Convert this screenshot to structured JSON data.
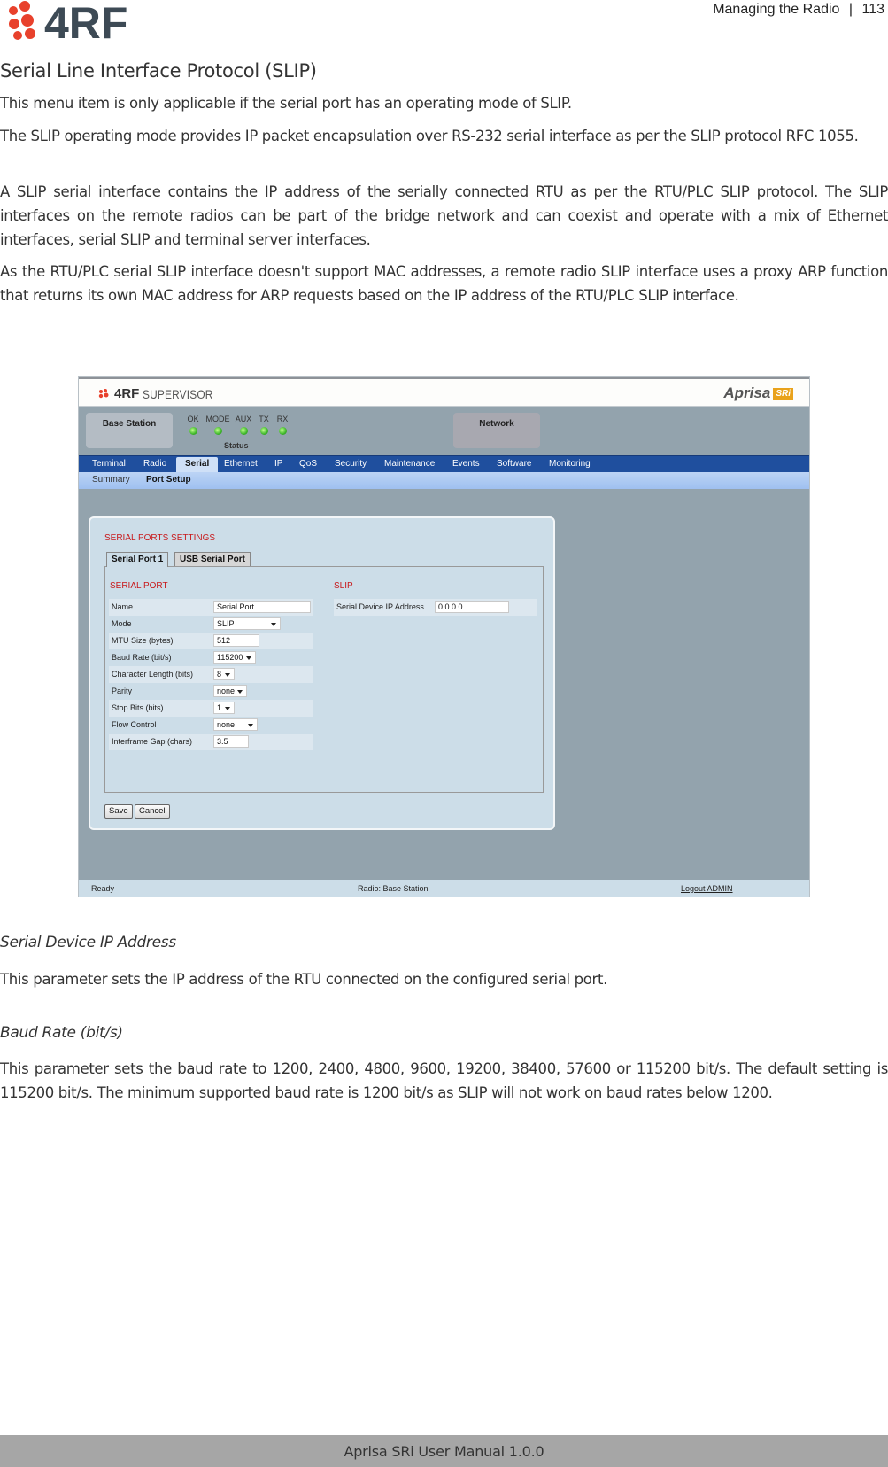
{
  "header": {
    "logo_text": "4RF",
    "section": "Managing the Radio",
    "separator": "|",
    "page_number": "113"
  },
  "title": "Serial Line Interface Protocol (SLIP)",
  "paragraphs": [
    "This menu item is only applicable if the serial port has an operating mode of SLIP.",
    "The SLIP operating mode provides IP packet encapsulation over RS-232 serial interface as per the SLIP protocol RFC 1055.",
    "A SLIP serial interface contains the IP address of the serially connected RTU as per the RTU/PLC SLIP protocol. The SLIP interfaces on the remote radios can be part of the bridge network and can coexist and operate with a mix of Ethernet interfaces, serial SLIP and terminal server interfaces.",
    "As the RTU/PLC serial SLIP interface doesn't support MAC addresses, a remote radio SLIP interface uses a proxy ARP function that returns its own MAC address for ARP requests based on the IP address of the RTU/PLC SLIP interface."
  ],
  "screenshot": {
    "app_logo": "4RF",
    "app_name": "SUPERVISOR",
    "brand": "Aprisa",
    "brand_badge": "SRi",
    "station_label": "Base Station",
    "network_label": "Network",
    "status_label": "Status",
    "leds": [
      {
        "label": "OK",
        "state": "green"
      },
      {
        "label": "MODE",
        "state": "green"
      },
      {
        "label": "AUX",
        "state": "green"
      },
      {
        "label": "TX",
        "state": "green"
      },
      {
        "label": "RX",
        "state": "green"
      }
    ],
    "nav": [
      "Terminal",
      "Radio",
      "Serial",
      "Ethernet",
      "IP",
      "QoS",
      "Security",
      "Maintenance",
      "Events",
      "Software",
      "Monitoring"
    ],
    "nav_active": "Serial",
    "subnav": [
      "Summary",
      "Port Setup"
    ],
    "subnav_active": "Port Setup",
    "panel_title": "SERIAL PORTS SETTINGS",
    "tabs": [
      "Serial Port 1",
      "USB Serial Port"
    ],
    "tab_active": "Serial Port 1",
    "serial_port": {
      "title": "SERIAL PORT",
      "rows": [
        {
          "label": "Name",
          "value": "Serial Port",
          "type": "text"
        },
        {
          "label": "Mode",
          "value": "SLIP",
          "type": "select"
        },
        {
          "label": "MTU Size (bytes)",
          "value": "512",
          "type": "text"
        },
        {
          "label": "Baud Rate (bit/s)",
          "value": "115200",
          "type": "select"
        },
        {
          "label": "Character Length (bits)",
          "value": "8",
          "type": "select"
        },
        {
          "label": "Parity",
          "value": "none",
          "type": "select"
        },
        {
          "label": "Stop Bits (bits)",
          "value": "1",
          "type": "select"
        },
        {
          "label": "Flow Control",
          "value": "none",
          "type": "select"
        },
        {
          "label": "Interframe Gap (chars)",
          "value": "3.5",
          "type": "text"
        }
      ]
    },
    "slip": {
      "title": "SLIP",
      "label": "Serial Device IP Address",
      "value": "0.0.0.0"
    },
    "buttons": {
      "save": "Save",
      "cancel": "Cancel"
    },
    "statusbar": {
      "state": "Ready",
      "radio": "Radio: Base Station",
      "logout": "Logout ADMIN"
    }
  },
  "sections": [
    {
      "heading": "Serial Device IP Address",
      "body": "This parameter sets the IP address of the RTU connected on the configured serial port."
    },
    {
      "heading": "Baud Rate (bit/s)",
      "body": "This parameter sets the baud rate to 1200, 2400, 4800, 9600, 19200, 38400, 57600 or 115200 bit/s. The default setting is 115200 bit/s. The minimum supported baud rate is 1200 bit/s as SLIP will not work on baud rates below 1200."
    }
  ],
  "footer": "Aprisa SRi User Manual 1.0.0"
}
